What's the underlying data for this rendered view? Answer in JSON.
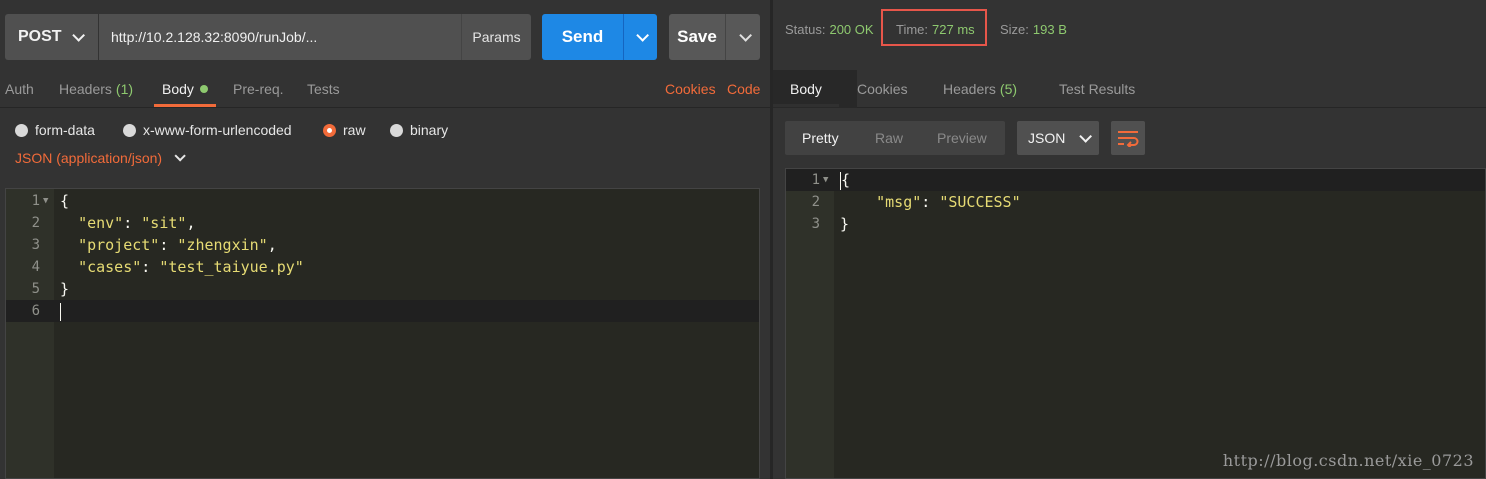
{
  "request": {
    "method": "POST",
    "url": "http://10.2.128.32:8090/runJob/...",
    "params_label": "Params",
    "send_label": "Send",
    "save_label": "Save"
  },
  "request_tabs": {
    "auth": "Auth",
    "headers": "Headers",
    "headers_count": "(1)",
    "body": "Body",
    "prereq": "Pre-req.",
    "tests": "Tests",
    "cookies": "Cookies",
    "code": "Code"
  },
  "body_types": {
    "form_data": "form-data",
    "urlencoded": "x-www-form-urlencoded",
    "raw": "raw",
    "binary": "binary",
    "selected": "raw",
    "content_type": "JSON (application/json)"
  },
  "request_body": {
    "lines": [
      {
        "n": "1",
        "text": "{"
      },
      {
        "n": "2",
        "key": "\"env\"",
        "sep": ": ",
        "val": "\"sit\"",
        "tail": ","
      },
      {
        "n": "3",
        "key": "\"project\"",
        "sep": ": ",
        "val": "\"zhengxin\"",
        "tail": ","
      },
      {
        "n": "4",
        "key": "\"cases\"",
        "sep": ": ",
        "val": "\"test_taiyue.py\"",
        "tail": ""
      },
      {
        "n": "5",
        "text": "}"
      },
      {
        "n": "6",
        "text": ""
      }
    ]
  },
  "response_meta": {
    "status_label": "Status:",
    "status_value": "200 OK",
    "time_label": "Time:",
    "time_value": "727 ms",
    "size_label": "Size:",
    "size_value": "193 B"
  },
  "response_tabs": {
    "body": "Body",
    "cookies": "Cookies",
    "headers": "Headers",
    "headers_count": "(5)",
    "test_results": "Test Results"
  },
  "response_view": {
    "pretty": "Pretty",
    "raw": "Raw",
    "preview": "Preview",
    "format": "JSON"
  },
  "response_body": {
    "lines": [
      {
        "n": "1",
        "text": "{"
      },
      {
        "n": "2",
        "key": "\"msg\"",
        "sep": ": ",
        "val": "\"SUCCESS\""
      },
      {
        "n": "3",
        "text": "}"
      }
    ]
  },
  "watermark": "http://blog.csdn.net/xie_0723",
  "colors": {
    "accent_orange": "#f26b3a",
    "send_blue": "#1e88e5",
    "status_green": "#8ec96f",
    "highlight_red": "#e7564a"
  }
}
